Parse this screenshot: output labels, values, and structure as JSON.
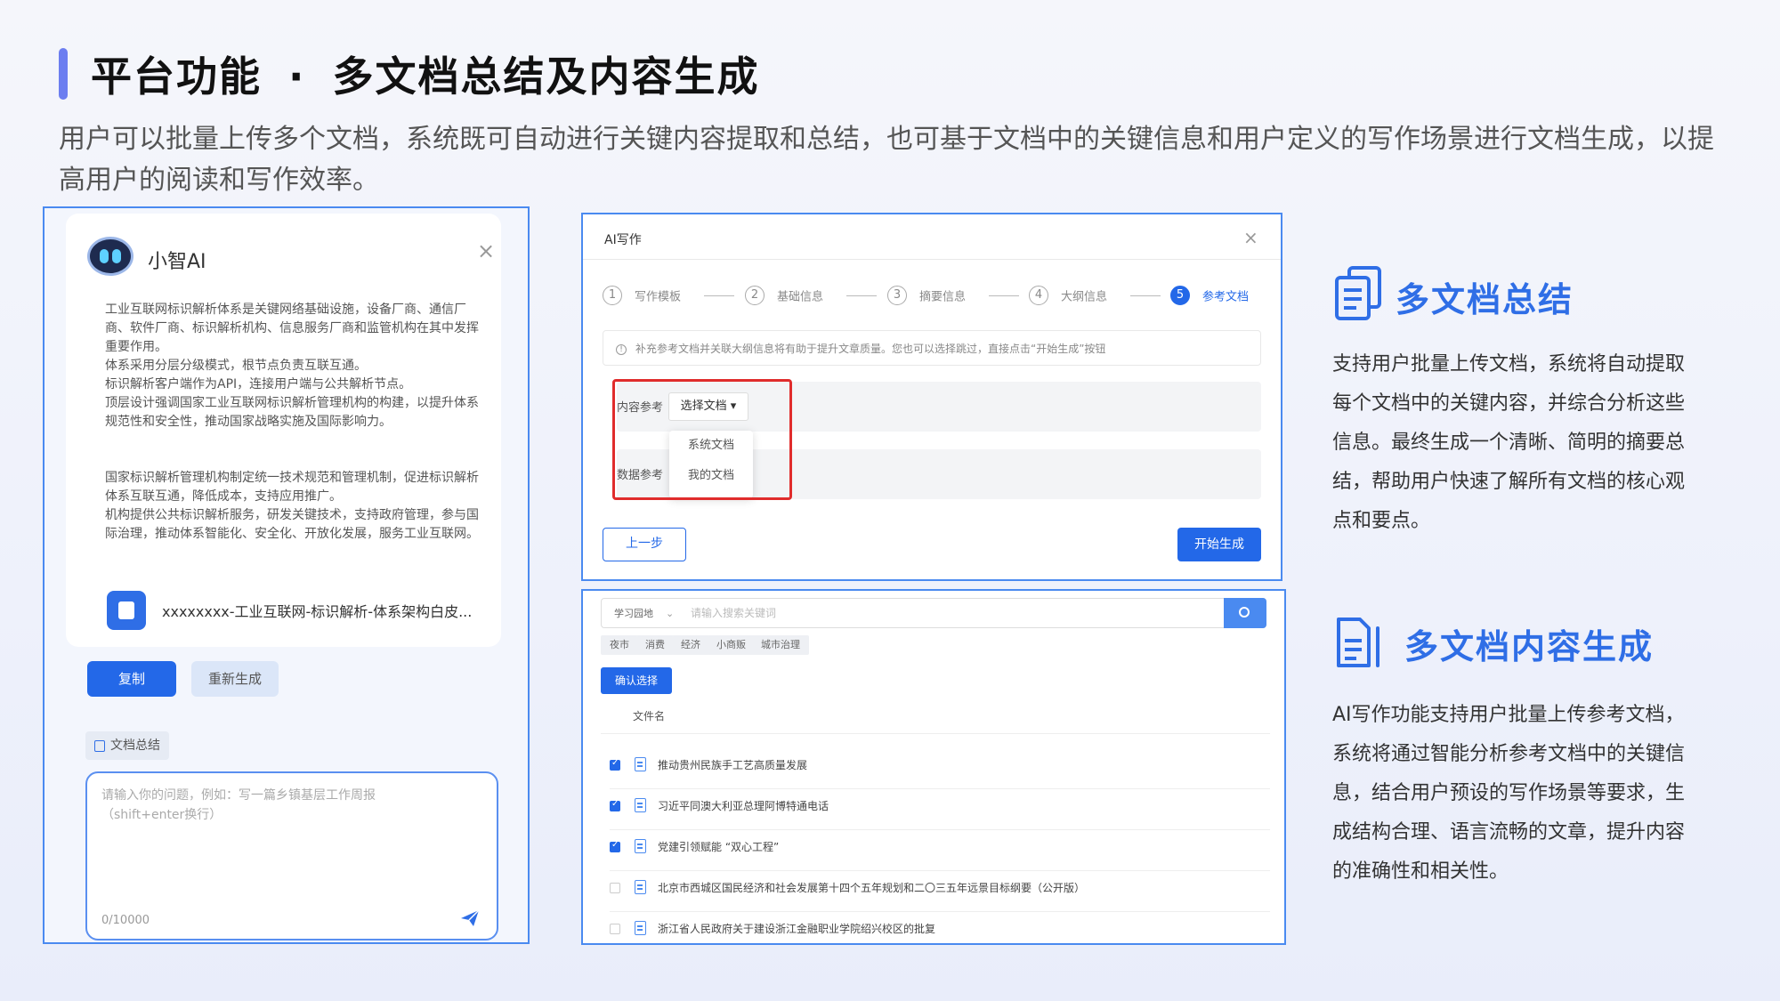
{
  "header": {
    "title": "平台功能",
    "separator": "·",
    "subtitle": "多文档总结及内容生成",
    "intro": "用户可以批量上传多个文档，系统既可自动进行关键内容提取和总结，也可基于文档中的关键信息和用户定义的写作场景进行文档生成，以提高用户的阅读和写作效率。"
  },
  "chat": {
    "assistant_name": "小智AI",
    "close": "×",
    "body_block1": [
      "工业互联网标识解析体系是关键网络基础设施，设备厂商、通信厂商、软件厂商、标识解析机构、信息服务厂商和监管机构在其中发挥重要作用。",
      "体系采用分层分级模式，根节点负责互联互通。",
      "标识解析客户端作为API，连接用户端与公共解析节点。",
      "顶层设计强调国家工业互联网标识解析管理机构的构建，以提升体系规范性和安全性，推动国家战略实施及国际影响力。"
    ],
    "body_block2": [
      "国家标识解析管理机构制定统一技术规范和管理机制，促进标识解析体系互联互通，降低成本，支持应用推广。",
      "机构提供公共标识解析服务，研发关键技术，支持政府管理，参与国际治理，推动体系智能化、安全化、开放化发展，服务工业互联网。"
    ],
    "file_name": "xxxxxxxx-工业互联网-标识解析-体系架构白皮...",
    "copy_label": "复制",
    "regenerate_label": "重新生成",
    "doc_summary_tag": "文档总结",
    "input_placeholder": "请输入你的问题，例如：写一篇乡镇基层工作周报\n（shift+enter换行）",
    "counter": "0/10000",
    "icons": [
      "robot-icon",
      "file-icon",
      "document-icon",
      "send-icon"
    ]
  },
  "ai_writing": {
    "title": "AI写作",
    "close": "×",
    "steps": [
      {
        "num": "1",
        "label": "写作模板"
      },
      {
        "num": "2",
        "label": "基础信息"
      },
      {
        "num": "3",
        "label": "摘要信息"
      },
      {
        "num": "4",
        "label": "大纲信息"
      },
      {
        "num": "5",
        "label": "参考文档"
      }
    ],
    "active_step": 5,
    "notice": "补充参考文档并关联大纲信息将有助于提升文章质量。您也可以选择跳过，直接点击“开始生成”按钮",
    "content_ref_label": "内容参考",
    "data_ref_label": "数据参考",
    "select_label": "选择文档",
    "dropdown_options": [
      "系统文档",
      "我的文档"
    ],
    "prev_label": "上一步",
    "start_label": "开始生成"
  },
  "doc_list": {
    "scope": "学习园地",
    "search_placeholder": "请输入搜索关键词",
    "tags": [
      "夜市",
      "消费",
      "经济",
      "小商贩",
      "城市治理"
    ],
    "confirm_label": "确认选择",
    "column_header": "文件名",
    "rows": [
      {
        "name": "推动贵州民族手工艺高质量发展",
        "checked": true
      },
      {
        "name": "习近平同澳大利亚总理阿博特通电话",
        "checked": true
      },
      {
        "name": "党建引领赋能 “双心工程”",
        "checked": true
      },
      {
        "name": "北京市西城区国民经济和社会发展第十四个五年规划和二〇三五年远景目标纲要（公开版）",
        "checked": false
      },
      {
        "name": "浙江省人民政府关于建设浙江金融职业学院绍兴校区的批复",
        "checked": false
      }
    ]
  },
  "features": [
    {
      "title": "多文档总结",
      "icon": "multi-document-icon",
      "description": "支持用户批量上传文档，系统将自动提取每个文档中的关键内容，并综合分析这些信息。最终生成一个清晰、简明的摘要总结，帮助用户快速了解所有文档的核心观点和要点。"
    },
    {
      "title": "多文档内容生成",
      "icon": "document-generate-icon",
      "description": "AI写作功能支持用户批量上传参考文档，系统将通过智能分析参考文档中的关键信息，结合用户预设的写作场景等要求，生成结构合理、语言流畅的文章，提升内容的准确性和相关性。"
    }
  ],
  "colors": {
    "accent": "#2368e8",
    "title_blue": "#2f6ee6",
    "highlight": "#e02c2c"
  }
}
